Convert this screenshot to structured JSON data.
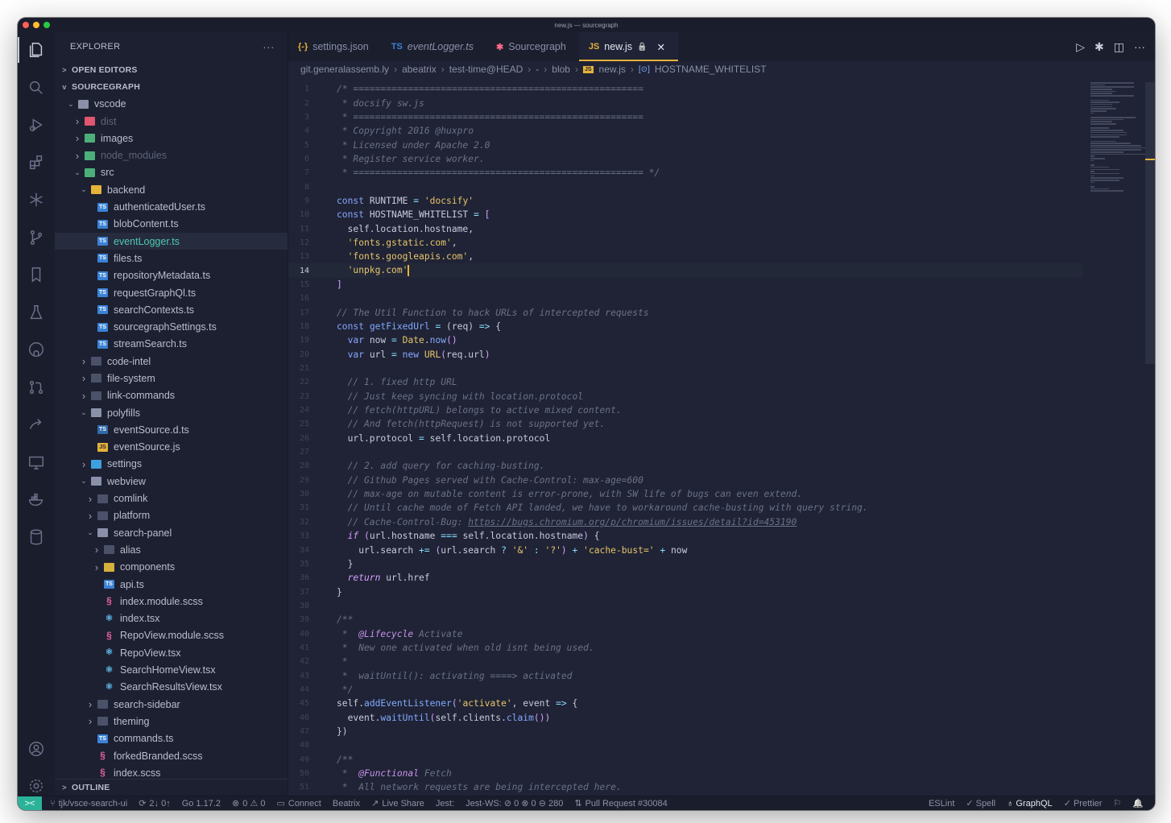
{
  "window": {
    "title": "new.js — sourcegraph"
  },
  "activity_bar": {
    "items": [
      "files-icon",
      "search-icon",
      "run-debug-icon",
      "extensions-icon",
      "sourcegraph-icon",
      "source-control-icon",
      "bookmarks-icon",
      "testing-icon",
      "github-icon",
      "pull-request-icon",
      "live-share-icon",
      "remote-explorer-icon",
      "docker-icon",
      "database-icon"
    ],
    "bottom": [
      "account-icon",
      "settings-gear-icon"
    ]
  },
  "explorer": {
    "title": "EXPLORER",
    "more": "···",
    "open_editors": "OPEN EDITORS",
    "root": "SOURCEGRAPH",
    "outline": "OUTLINE",
    "tree": [
      {
        "indent": 1,
        "chev": "v",
        "icon": "folder-open",
        "label": "vscode"
      },
      {
        "indent": 2,
        "chev": ">",
        "icon": "folder-red",
        "label": "dist",
        "dim": true
      },
      {
        "indent": 2,
        "chev": ">",
        "icon": "folder-green",
        "label": "images"
      },
      {
        "indent": 2,
        "chev": ">",
        "icon": "folder-green",
        "label": "node_modules",
        "dim": true
      },
      {
        "indent": 2,
        "chev": "v",
        "icon": "folder-green-open",
        "label": "src"
      },
      {
        "indent": 3,
        "chev": "v",
        "icon": "folder-yellow-open",
        "label": "backend"
      },
      {
        "indent": 4,
        "chev": "",
        "icon": "ts",
        "label": "authenticatedUser.ts"
      },
      {
        "indent": 4,
        "chev": "",
        "icon": "ts",
        "label": "blobContent.ts"
      },
      {
        "indent": 4,
        "chev": "",
        "icon": "ts",
        "label": "eventLogger.ts",
        "selected": true
      },
      {
        "indent": 4,
        "chev": "",
        "icon": "ts",
        "label": "files.ts"
      },
      {
        "indent": 4,
        "chev": "",
        "icon": "ts",
        "label": "repositoryMetadata.ts"
      },
      {
        "indent": 4,
        "chev": "",
        "icon": "ts",
        "label": "requestGraphQl.ts"
      },
      {
        "indent": 4,
        "chev": "",
        "icon": "ts",
        "label": "searchContexts.ts"
      },
      {
        "indent": 4,
        "chev": "",
        "icon": "ts",
        "label": "sourcegraphSettings.ts"
      },
      {
        "indent": 4,
        "chev": "",
        "icon": "ts",
        "label": "streamSearch.ts"
      },
      {
        "indent": 3,
        "chev": ">",
        "icon": "folder",
        "label": "code-intel"
      },
      {
        "indent": 3,
        "chev": ">",
        "icon": "folder",
        "label": "file-system"
      },
      {
        "indent": 3,
        "chev": ">",
        "icon": "folder",
        "label": "link-commands"
      },
      {
        "indent": 3,
        "chev": "v",
        "icon": "folder-open",
        "label": "polyfills"
      },
      {
        "indent": 4,
        "chev": "",
        "icon": "dts",
        "label": "eventSource.d.ts"
      },
      {
        "indent": 4,
        "chev": "",
        "icon": "js",
        "label": "eventSource.js"
      },
      {
        "indent": 3,
        "chev": ">",
        "icon": "folder-blue",
        "label": "settings"
      },
      {
        "indent": 3,
        "chev": "v",
        "icon": "folder-open",
        "label": "webview"
      },
      {
        "indent": 4,
        "chev": ">",
        "icon": "folder",
        "label": "comlink"
      },
      {
        "indent": 4,
        "chev": ">",
        "icon": "folder",
        "label": "platform"
      },
      {
        "indent": 4,
        "chev": "v",
        "icon": "folder-open",
        "label": "search-panel"
      },
      {
        "indent": 5,
        "chev": ">",
        "icon": "folder",
        "label": "alias"
      },
      {
        "indent": 5,
        "chev": ">",
        "icon": "folder-yellow",
        "label": "components"
      },
      {
        "indent": 5,
        "chev": "",
        "icon": "ts",
        "label": "api.ts"
      },
      {
        "indent": 5,
        "chev": "",
        "icon": "scss",
        "label": "index.module.scss"
      },
      {
        "indent": 5,
        "chev": "",
        "icon": "tsx",
        "label": "index.tsx"
      },
      {
        "indent": 5,
        "chev": "",
        "icon": "scss",
        "label": "RepoView.module.scss"
      },
      {
        "indent": 5,
        "chev": "",
        "icon": "tsx",
        "label": "RepoView.tsx"
      },
      {
        "indent": 5,
        "chev": "",
        "icon": "tsx",
        "label": "SearchHomeView.tsx"
      },
      {
        "indent": 5,
        "chev": "",
        "icon": "tsx",
        "label": "SearchResultsView.tsx"
      },
      {
        "indent": 4,
        "chev": ">",
        "icon": "folder",
        "label": "search-sidebar"
      },
      {
        "indent": 4,
        "chev": ">",
        "icon": "folder",
        "label": "theming"
      },
      {
        "indent": 4,
        "chev": "",
        "icon": "ts",
        "label": "commands.ts"
      },
      {
        "indent": 4,
        "chev": "",
        "icon": "scss",
        "label": "forkedBranded.scss"
      },
      {
        "indent": 4,
        "chev": "",
        "icon": "scss",
        "label": "index.scss"
      }
    ]
  },
  "tabs": [
    {
      "label": "settings.json",
      "icon": "{-}",
      "icon_color": "#e5b23a",
      "italic": false
    },
    {
      "label": "eventLogger.ts",
      "icon": "TS",
      "icon_color": "#3b82d6",
      "italic": true
    },
    {
      "label": "Sourcegraph",
      "icon": "✱",
      "icon_color": "#ff6a8a",
      "italic": false
    },
    {
      "label": "new.js",
      "icon": "JS",
      "icon_color": "#e5b23a",
      "italic": false,
      "active": true,
      "lock": "🔒",
      "close": "✕"
    }
  ],
  "tab_actions": [
    "▷",
    "✱",
    "◫",
    "···"
  ],
  "breadcrumb": [
    "git.generalassemb.ly",
    "abeatrix",
    "test-time@HEAD",
    "-",
    "blob",
    "new.js",
    "HOSTNAME_WHITELIST"
  ],
  "editor": {
    "current_line": 14,
    "lines": [
      [
        [
          "cm",
          "/* ====================================================="
        ]
      ],
      [
        [
          "cm",
          " * docsify sw.js"
        ]
      ],
      [
        [
          "cm",
          " * ====================================================="
        ]
      ],
      [
        [
          "cm",
          " * Copyright 2016 @huxpro"
        ]
      ],
      [
        [
          "cm",
          " * Licensed under Apache 2.0"
        ]
      ],
      [
        [
          "cm",
          " * Register service worker."
        ]
      ],
      [
        [
          "cm",
          " * ===================================================== */"
        ]
      ],
      [
        [
          "var",
          ""
        ]
      ],
      [
        [
          "kw",
          "const "
        ],
        [
          "var",
          "RUNTIME "
        ],
        [
          "op",
          "= "
        ],
        [
          "str",
          "'docsify'"
        ]
      ],
      [
        [
          "kw",
          "const "
        ],
        [
          "var",
          "HOSTNAME_WHITELIST "
        ],
        [
          "op",
          "= "
        ],
        [
          "br",
          "["
        ]
      ],
      [
        [
          "var",
          "  self.location.hostname,"
        ]
      ],
      [
        [
          "str",
          "  'fonts.gstatic.com'"
        ],
        [
          "var",
          ","
        ]
      ],
      [
        [
          "str",
          "  'fonts.googleapis.com'"
        ],
        [
          "var",
          ","
        ]
      ],
      [
        [
          "str",
          "  'unpkg.com'"
        ],
        [
          "cursor",
          ""
        ]
      ],
      [
        [
          "br",
          "]"
        ]
      ],
      [
        [
          "var",
          ""
        ]
      ],
      [
        [
          "cm",
          "// The Util Function to hack URLs of intercepted requests"
        ]
      ],
      [
        [
          "kw",
          "const "
        ],
        [
          "fn",
          "getFixedUrl "
        ],
        [
          "op",
          "= "
        ],
        [
          "var",
          "(req) "
        ],
        [
          "op",
          "=> "
        ],
        [
          "var",
          "{"
        ]
      ],
      [
        [
          "kw",
          "  var "
        ],
        [
          "var",
          "now "
        ],
        [
          "op",
          "= "
        ],
        [
          "str",
          "Date"
        ],
        [
          "var",
          "."
        ],
        [
          "fn",
          "now"
        ],
        [
          "br",
          "()"
        ]
      ],
      [
        [
          "kw",
          "  var "
        ],
        [
          "var",
          "url "
        ],
        [
          "op",
          "= "
        ],
        [
          "kw",
          "new "
        ],
        [
          "str",
          "URL"
        ],
        [
          "br",
          "("
        ],
        [
          "var",
          "req.url"
        ],
        [
          "br",
          ")"
        ]
      ],
      [
        [
          "var",
          ""
        ]
      ],
      [
        [
          "cm",
          "  // 1. fixed http URL"
        ]
      ],
      [
        [
          "cm",
          "  // Just keep syncing with location.protocol"
        ]
      ],
      [
        [
          "cm",
          "  // fetch(httpURL) belongs to active mixed content."
        ]
      ],
      [
        [
          "cm",
          "  // And fetch(httpRequest) is not supported yet."
        ]
      ],
      [
        [
          "var",
          "  url.protocol "
        ],
        [
          "op",
          "= "
        ],
        [
          "var",
          "self.location.protocol"
        ]
      ],
      [
        [
          "var",
          ""
        ]
      ],
      [
        [
          "cm",
          "  // 2. add query for caching-busting."
        ]
      ],
      [
        [
          "cm",
          "  // Github Pages served with Cache-Control: max-age=600"
        ]
      ],
      [
        [
          "cm",
          "  // max-age on mutable content is error-prone, with SW life of bugs can even extend."
        ]
      ],
      [
        [
          "cm",
          "  // Until cache mode of Fetch API landed, we have to workaround cache-busting with query string."
        ]
      ],
      [
        [
          "cm",
          "  // Cache-Control-Bug: "
        ],
        [
          "url",
          "https://bugs.chromium.org/p/chromium/issues/detail?id=453190"
        ]
      ],
      [
        [
          "kwi",
          "  if "
        ],
        [
          "br",
          "("
        ],
        [
          "var",
          "url.hostname "
        ],
        [
          "op",
          "=== "
        ],
        [
          "var",
          "self.location.hostname"
        ],
        [
          "br",
          ")"
        ],
        [
          "var",
          " {"
        ]
      ],
      [
        [
          "var",
          "    url.search "
        ],
        [
          "op",
          "+= "
        ],
        [
          "br",
          "("
        ],
        [
          "var",
          "url.search "
        ],
        [
          "op",
          "? "
        ],
        [
          "str",
          "'&' "
        ],
        [
          "op",
          ": "
        ],
        [
          "str",
          "'?'"
        ],
        [
          "br",
          ")"
        ],
        [
          "op",
          " + "
        ],
        [
          "str",
          "'cache-bust=' "
        ],
        [
          "op",
          "+ "
        ],
        [
          "var",
          "now"
        ]
      ],
      [
        [
          "var",
          "  }"
        ]
      ],
      [
        [
          "kwi",
          "  return "
        ],
        [
          "var",
          "url.href"
        ]
      ],
      [
        [
          "var",
          "}"
        ]
      ],
      [
        [
          "var",
          ""
        ]
      ],
      [
        [
          "cm",
          "/**"
        ]
      ],
      [
        [
          "cm",
          " *  "
        ],
        [
          "anno",
          "@Lifecycle"
        ],
        [
          "cm",
          " Activate"
        ]
      ],
      [
        [
          "cm",
          " *  New one activated when old isnt being used."
        ]
      ],
      [
        [
          "cm",
          " *"
        ]
      ],
      [
        [
          "cm",
          " *  waitUntil(): activating ====> activated"
        ]
      ],
      [
        [
          "cm",
          " */"
        ]
      ],
      [
        [
          "var",
          "self."
        ],
        [
          "fn",
          "addEventListener"
        ],
        [
          "br",
          "("
        ],
        [
          "str",
          "'activate'"
        ],
        [
          "var",
          ", event "
        ],
        [
          "op",
          "=> "
        ],
        [
          "var",
          "{"
        ]
      ],
      [
        [
          "var",
          "  event."
        ],
        [
          "fn",
          "waitUntil"
        ],
        [
          "br",
          "("
        ],
        [
          "var",
          "self.clients."
        ],
        [
          "fn",
          "claim"
        ],
        [
          "br",
          "())"
        ]
      ],
      [
        [
          "var",
          "})"
        ]
      ],
      [
        [
          "var",
          ""
        ]
      ],
      [
        [
          "cm",
          "/**"
        ]
      ],
      [
        [
          "cm",
          " *  "
        ],
        [
          "anno",
          "@Functional"
        ],
        [
          "cm",
          " Fetch"
        ]
      ],
      [
        [
          "cm",
          " *  All network requests are being intercepted here."
        ]
      ]
    ]
  },
  "status_bar": {
    "left": [
      {
        "icon": "⑂",
        "label": "tjk/vsce-search-ui"
      },
      {
        "icon": "⟳",
        "label": "2↓ 0↑"
      },
      {
        "icon": "",
        "label": "Go 1.17.2"
      },
      {
        "icon": "⊗",
        "label": "0 ⚠ 0"
      },
      {
        "icon": "▭",
        "label": "Connect"
      },
      {
        "icon": "",
        "label": "Beatrix"
      },
      {
        "icon": "↗",
        "label": "Live Share"
      },
      {
        "icon": "",
        "label": "Jest:"
      },
      {
        "icon": "",
        "label": "Jest-WS: ⊘ 0 ⊗ 0 ⊖ 280"
      },
      {
        "icon": "⇅",
        "label": "Pull Request #30084"
      }
    ],
    "right": [
      {
        "label": "ESLint",
        "bold": false
      },
      {
        "label": "✓ Spell",
        "bold": false
      },
      {
        "label": "♁ GraphQL",
        "bold": true
      },
      {
        "label": "✓ Prettier",
        "bold": false
      },
      {
        "label": "⚐",
        "bold": false
      },
      {
        "label": "🔔",
        "bold": false
      }
    ],
    "remote_icon": "><"
  }
}
